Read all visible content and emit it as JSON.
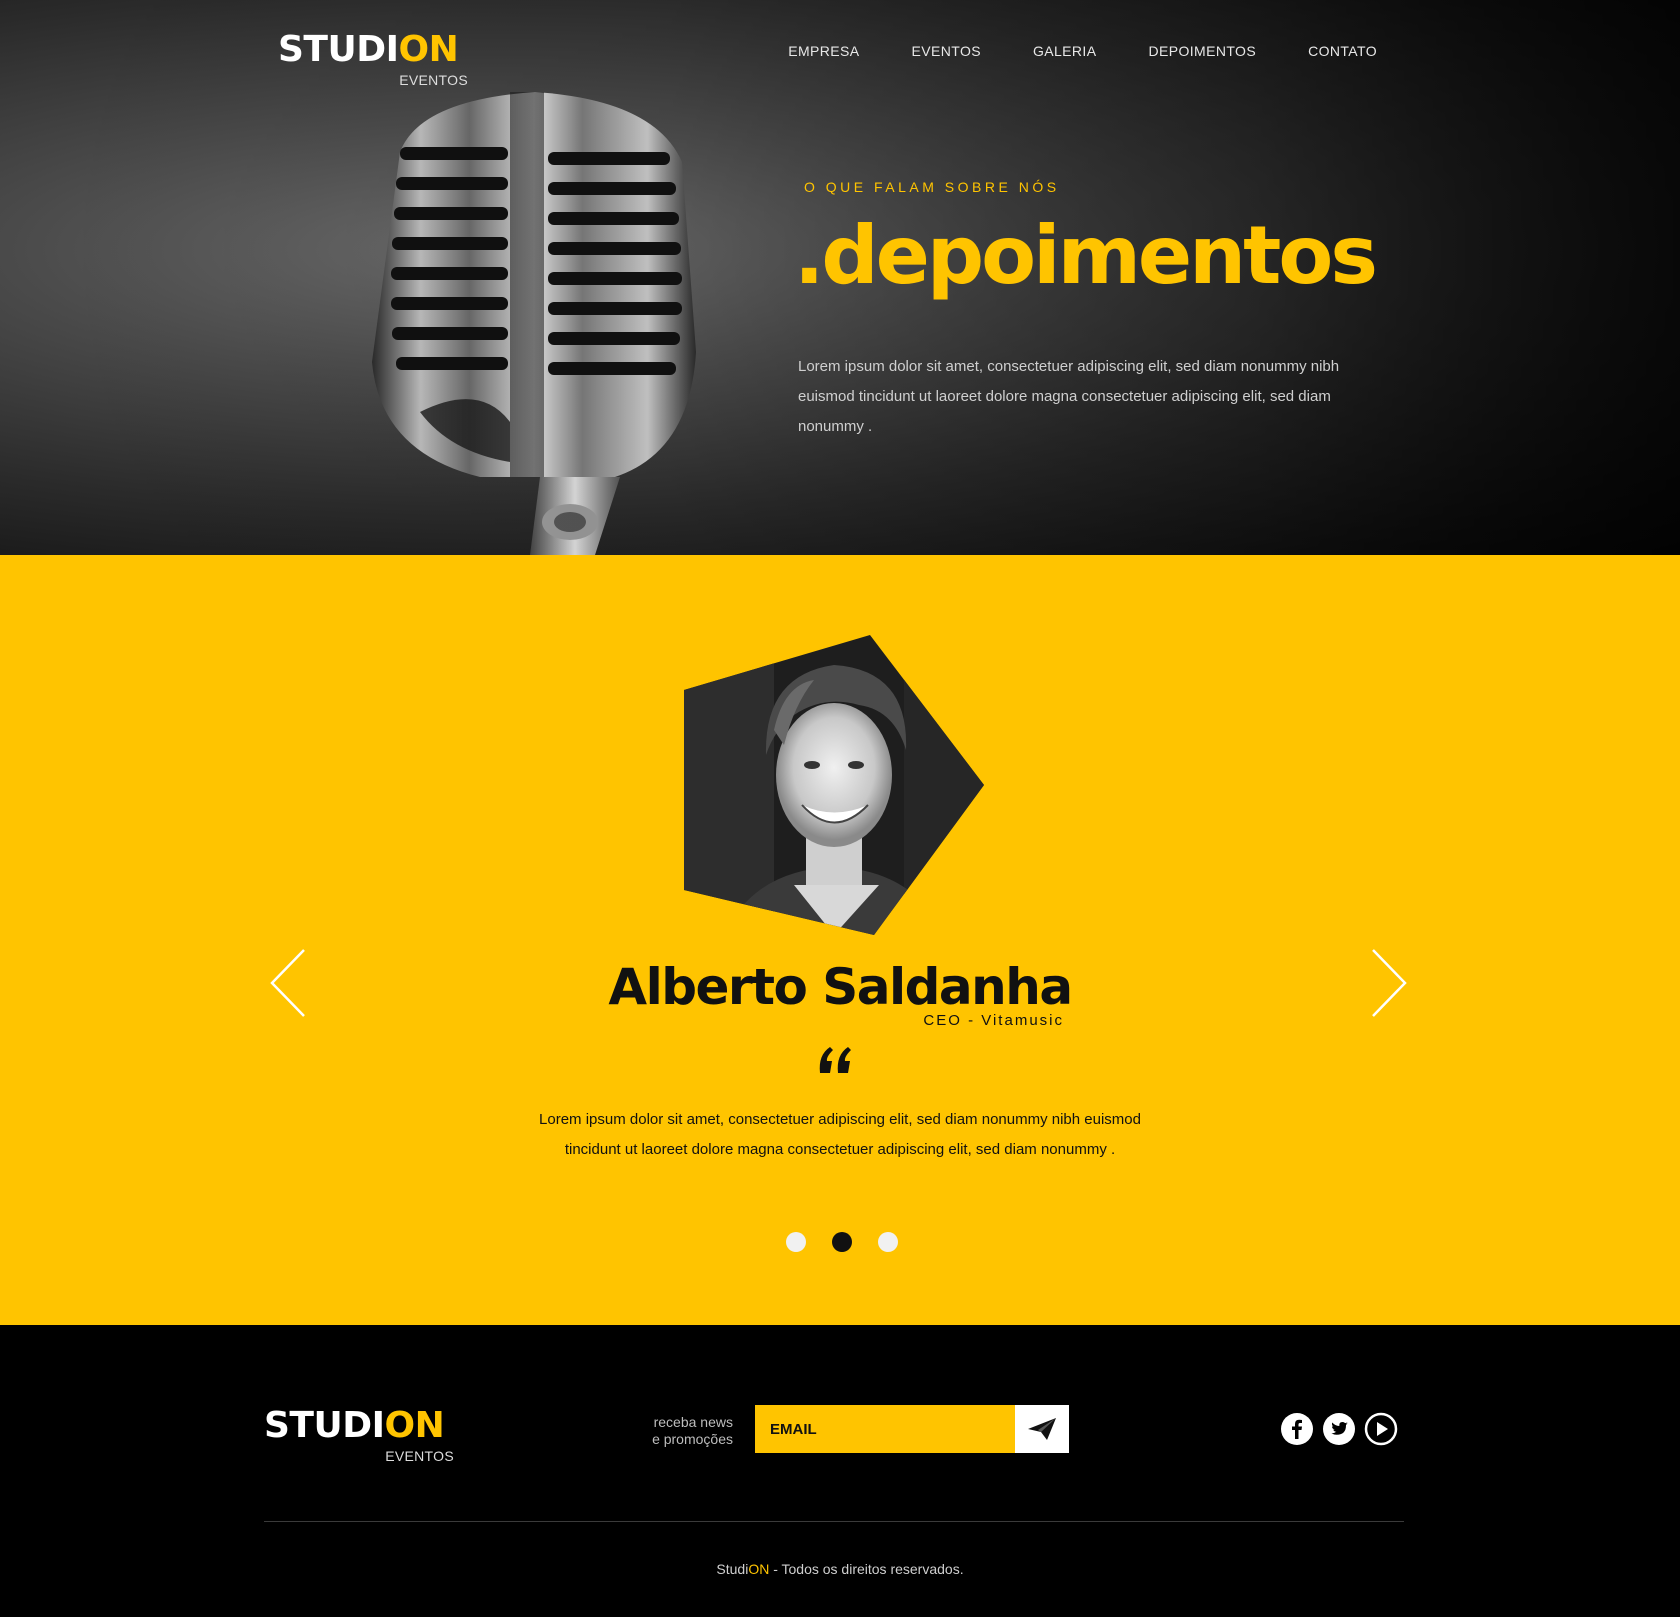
{
  "brand": {
    "name_white": "STUDI",
    "name_yellow": "ON",
    "subtitle": "EVENTOS"
  },
  "nav": {
    "items": [
      "EMPRESA",
      "EVENTOS",
      "GALERIA",
      "DEPOIMENTOS",
      "CONTATO"
    ]
  },
  "hero": {
    "eyebrow": "O QUE FALAM SOBRE NÓS",
    "title": ".depoimentos",
    "text": "Lorem ipsum dolor sit amet, consectetuer adipiscing elit, sed diam nonummy nibh euismod tincidunt ut laoreet dolore magna consectetuer adipiscing elit, sed diam nonummy ."
  },
  "testimonial": {
    "name": "Alberto Saldanha",
    "role": "CEO - Vitamusic",
    "text": "Lorem ipsum dolor sit amet, consectetuer adipiscing elit, sed diam nonummy nibh euismod tincidunt ut laoreet dolore magna consectetuer adipiscing elit, sed diam nonummy .",
    "slide_count": 3,
    "active_slide": 2
  },
  "footer": {
    "news_label_line1": "receba news",
    "news_label_line2": "e promoções",
    "email_placeholder": "EMAIL",
    "social_icons": [
      "facebook-icon",
      "twitter-icon",
      "play-icon"
    ],
    "copyright_brand_white": "Studi",
    "copyright_brand_yellow": "ON",
    "copyright_text": " - Todos os direitos reservados."
  },
  "colors": {
    "accent": "#ffc400",
    "dark": "#111111",
    "footer_bg": "#000000"
  }
}
